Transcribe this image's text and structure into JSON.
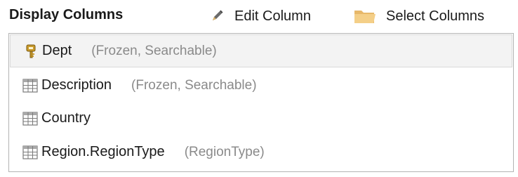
{
  "header": {
    "title": "Display Columns",
    "edit_label": "Edit Column",
    "select_label": "Select Columns"
  },
  "columns": [
    {
      "name": "Dept",
      "meta": "(Frozen, Searchable)",
      "icon": "key-icon",
      "selected": true
    },
    {
      "name": "Description",
      "meta": "(Frozen, Searchable)",
      "icon": "grid-icon",
      "selected": false
    },
    {
      "name": "Country",
      "meta": "",
      "icon": "grid-icon",
      "selected": false
    },
    {
      "name": "Region.RegionType",
      "meta": "(RegionType)",
      "icon": "grid-icon",
      "selected": false
    }
  ],
  "colors": {
    "selected_row_bg": "#f3f3f3",
    "meta_text": "#8a8a8a",
    "folder": "#f0c070",
    "key": "#b8922a"
  }
}
